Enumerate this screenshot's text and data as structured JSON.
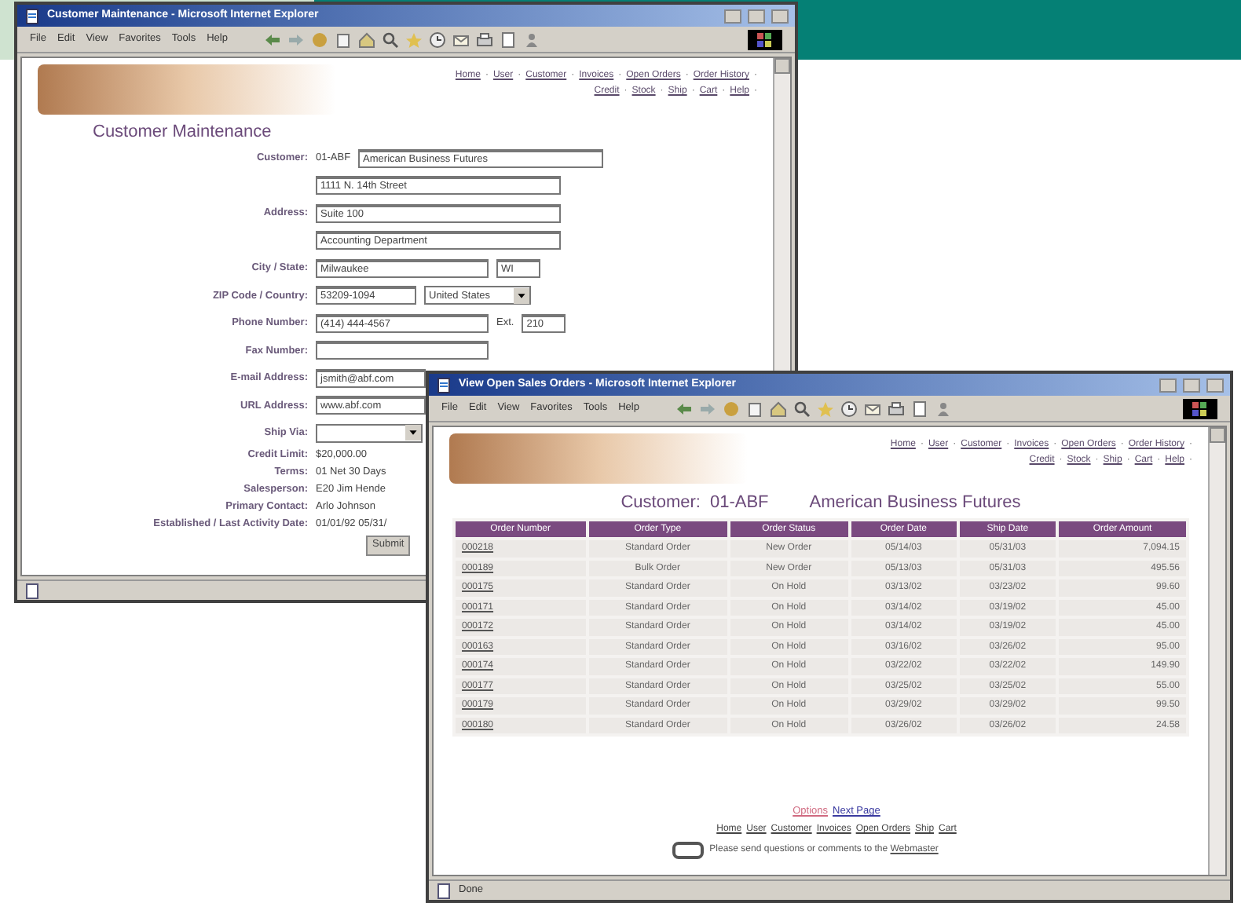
{
  "windows": [
    {
      "title": "Customer Maintenance - Microsoft Internet Explorer",
      "menu": [
        "File",
        "Edit",
        "View",
        "Favorites",
        "Tools",
        "Help"
      ],
      "nav_links": [
        [
          "Home",
          "User",
          "Customer",
          "Invoices",
          "Open Orders",
          "Order History"
        ],
        [
          "Credit",
          "Stock",
          "Ship",
          "Cart",
          "Help"
        ]
      ],
      "nav_separator": "·",
      "heading": "Customer Maintenance",
      "form": {
        "rows": [
          {
            "label": "Customer:",
            "items": [
              {
                "kind": "text",
                "value": "01-ABF"
              },
              {
                "kind": "field",
                "value": "American Business Futures"
              }
            ]
          },
          {
            "items": [
              {
                "kind": "field",
                "value": "1111 N. 14th Street"
              }
            ]
          },
          {
            "label": "Address:",
            "items": [
              {
                "kind": "field",
                "value": "Suite 100"
              }
            ]
          },
          {
            "items": [
              {
                "kind": "field",
                "value": "Accounting Department"
              }
            ]
          },
          {
            "label": "City / State:",
            "items": [
              {
                "kind": "wide_field",
                "value": "Milwaukee"
              },
              {
                "kind": "short_field",
                "value": "WI"
              }
            ]
          },
          {
            "label": "ZIP Code / Country:",
            "items": [
              {
                "kind": "medium_field",
                "value": "53209-1094"
              },
              {
                "kind": "select",
                "value": "United States"
              }
            ]
          },
          {
            "label": "Phone Number:",
            "items": [
              {
                "kind": "wide_field",
                "value": "(414) 444-4567"
              },
              {
                "kind": "text",
                "value": "Ext."
              },
              {
                "kind": "short_field",
                "value": "210"
              }
            ]
          },
          {
            "label": "Fax Number:",
            "items": [
              {
                "kind": "wide_field",
                "value": ""
              }
            ]
          },
          {
            "label": "E-mail Address:",
            "items": [
              {
                "kind": "cut_field",
                "value": "jsmith@abf.com"
              }
            ]
          },
          {
            "label": "URL Address:",
            "items": [
              {
                "kind": "cut_field",
                "value": "www.abf.com"
              }
            ]
          },
          {
            "label": "Ship Via:",
            "items": [
              {
                "kind": "select",
                "value": ""
              }
            ]
          },
          {
            "label": "Credit Limit:",
            "items": [
              {
                "kind": "text",
                "value": "$20,000.00"
              }
            ]
          },
          {
            "label": "Terms:",
            "items": [
              {
                "kind": "text",
                "value": "01  Net 30 Days"
              }
            ]
          },
          {
            "label": "Salesperson:",
            "items": [
              {
                "kind": "text",
                "value": "E20  Jim Hende"
              }
            ]
          },
          {
            "label": "Primary Contact:",
            "items": [
              {
                "kind": "text",
                "value": "Arlo Johnson"
              }
            ]
          },
          {
            "label": "Established / Last Activity Date:",
            "items": [
              {
                "kind": "text",
                "value": "01/01/92   05/31/"
              }
            ]
          }
        ],
        "submit": "Submit"
      }
    },
    {
      "title": "View Open Sales Orders - Microsoft Internet Explorer",
      "menu": [
        "File",
        "Edit",
        "View",
        "Favorites",
        "Tools",
        "Help"
      ],
      "nav_links": [
        [
          "Home",
          "User",
          "Customer",
          "Invoices",
          "Open Orders",
          "Order History"
        ],
        [
          "Credit",
          "Stock",
          "Ship",
          "Cart",
          "Help"
        ]
      ],
      "nav_separator": "·",
      "heading_parts": [
        "Customer:",
        "01-ABF",
        "American Business Futures"
      ],
      "table": {
        "columns": [
          "Order Number",
          "Order Type",
          "Order Status",
          "Order Date",
          "Ship Date",
          "Order Amount"
        ],
        "rows": [
          [
            "000218",
            "Standard Order",
            "New Order",
            "05/14/03",
            "05/31/03",
            "7,094.15"
          ],
          [
            "000189",
            "Bulk Order",
            "New Order",
            "05/13/03",
            "05/31/03",
            "495.56"
          ],
          [
            "000175",
            "Standard Order",
            "On Hold",
            "03/13/02",
            "03/23/02",
            "99.60"
          ],
          [
            "000171",
            "Standard Order",
            "On Hold",
            "03/14/02",
            "03/19/02",
            "45.00"
          ],
          [
            "000172",
            "Standard Order",
            "On Hold",
            "03/14/02",
            "03/19/02",
            "45.00"
          ],
          [
            "000163",
            "Standard Order",
            "On Hold",
            "03/16/02",
            "03/26/02",
            "95.00"
          ],
          [
            "000174",
            "Standard Order",
            "On Hold",
            "03/22/02",
            "03/22/02",
            "149.90"
          ],
          [
            "000177",
            "Standard Order",
            "On Hold",
            "03/25/02",
            "03/25/02",
            "55.00"
          ],
          [
            "000179",
            "Standard Order",
            "On Hold",
            "03/29/02",
            "03/29/02",
            "99.50"
          ],
          [
            "000180",
            "Standard Order",
            "On Hold",
            "03/26/02",
            "03/26/02",
            "24.58"
          ]
        ]
      },
      "pager": [
        "Options",
        "Next Page"
      ],
      "footer_links": [
        "Home",
        "User",
        "Customer",
        "Invoices",
        "Open Orders",
        "Ship",
        "Cart"
      ],
      "contact": {
        "text": "Please send questions or comments to the",
        "link": "Webmaster"
      },
      "status": "Done"
    }
  ]
}
